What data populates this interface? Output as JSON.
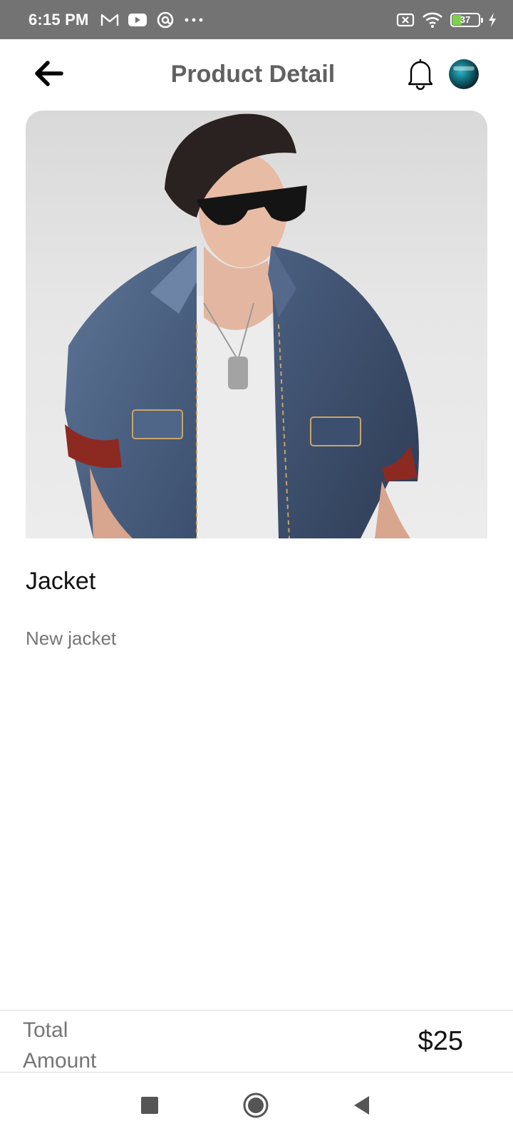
{
  "status_bar": {
    "time": "6:15 PM",
    "battery_level": "37",
    "battery_percent": 37,
    "icons": [
      "gmail-icon",
      "youtube-icon",
      "at-sign-icon",
      "more-dots-icon",
      "sim-off-icon",
      "wifi-icon",
      "battery-icon",
      "charging-icon"
    ]
  },
  "header": {
    "title": "Product Detail",
    "back_icon": "arrow-left-icon",
    "notification_icon": "bell-icon",
    "avatar_icon": "avatar"
  },
  "product": {
    "name": "Jacket",
    "description": "New jacket"
  },
  "footer": {
    "total_label": "Total Amount",
    "total_value": "$25"
  },
  "nav": {
    "icons": [
      "square-icon",
      "home-circle-icon",
      "back-triangle-icon"
    ]
  },
  "colors": {
    "status_bar": "#737373",
    "title": "#616161",
    "muted_text": "#757575",
    "battery_fill": "#7fd14a"
  }
}
